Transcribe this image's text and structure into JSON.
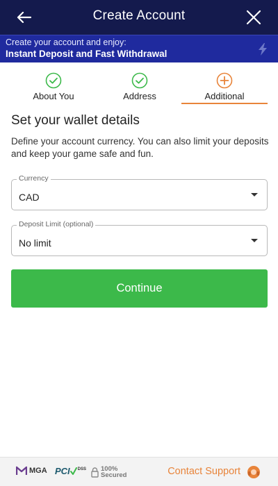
{
  "header": {
    "title": "Create Account"
  },
  "promo": {
    "line1": "Create your account and enjoy:",
    "line2": "Instant Deposit and Fast Withdrawal"
  },
  "steps": [
    {
      "label": "About You",
      "state": "done"
    },
    {
      "label": "Address",
      "state": "done"
    },
    {
      "label": "Additional",
      "state": "active"
    }
  ],
  "main": {
    "heading": "Set your wallet details",
    "description": "Define your account currency. You can also limit your deposits and keep your game safe and fun.",
    "currency": {
      "label": "Currency",
      "value": "CAD"
    },
    "deposit_limit": {
      "label": "Deposit Limit (optional)",
      "value": "No limit"
    },
    "continue_label": "Continue"
  },
  "footer": {
    "mga": "MGA",
    "pci": "PCI",
    "dss": "DSS",
    "secured_line1": "100%",
    "secured_line2": "Secured",
    "support_label": "Contact Support"
  },
  "colors": {
    "header_bg": "#141a4d",
    "promo_bg": "#1f2a9e",
    "step_done": "#3cb94a",
    "accent": "#e8843a",
    "continue_bg": "#3cb94a"
  },
  "icons": {
    "back": "arrow-left",
    "close": "x",
    "promo": "lightning-bolt",
    "step_done": "check-circle",
    "step_active": "plus-circle",
    "dropdown": "caret-down",
    "support": "headset"
  }
}
